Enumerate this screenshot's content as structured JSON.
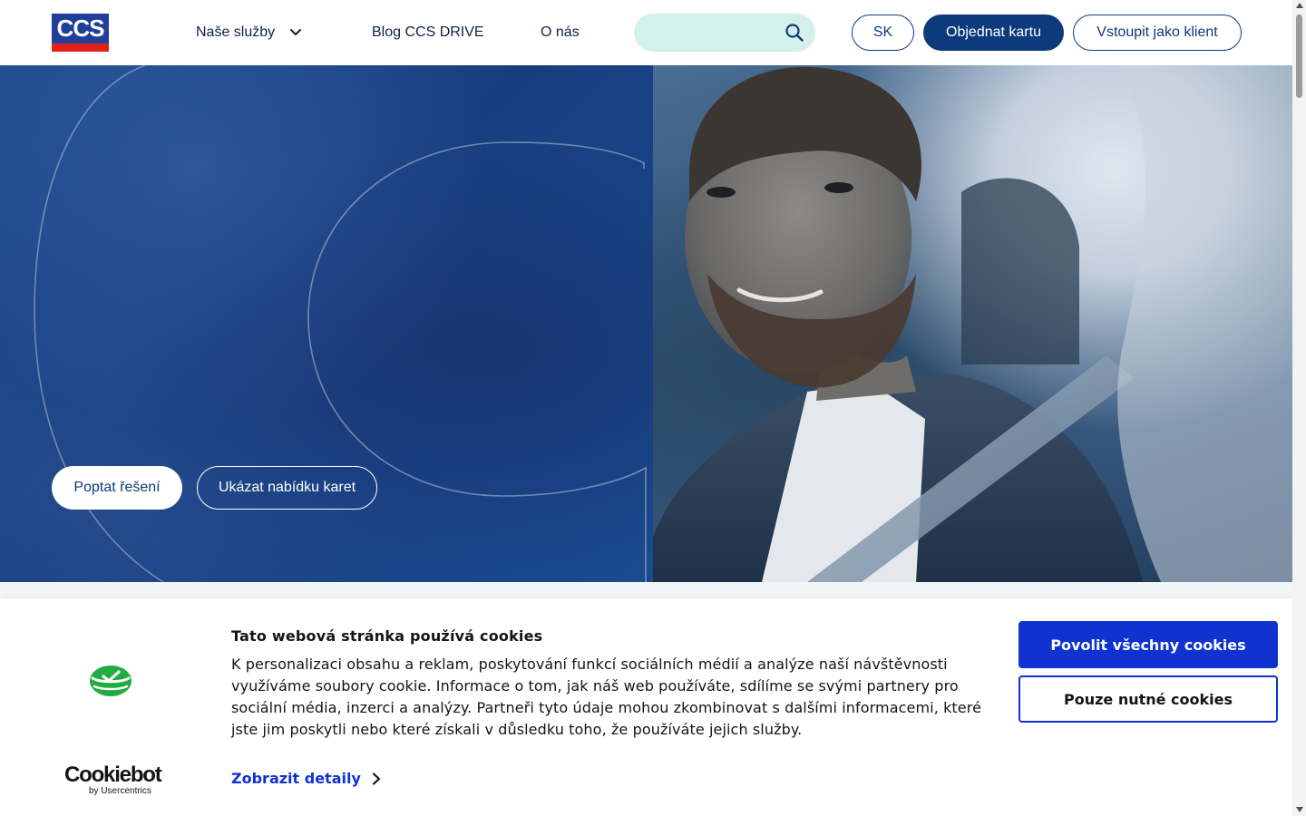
{
  "header": {
    "logo_text": "CCS",
    "nav": {
      "services": "Naše služby",
      "blog": "Blog CCS DRIVE",
      "about": "O nás"
    },
    "search": {
      "placeholder": "",
      "icon": "search-icon"
    },
    "buttons": {
      "language": "SK",
      "order_card": "Objednat kartu",
      "client_login": "Vstoupit jako klient"
    }
  },
  "hero": {
    "primary_button": "Poptat řešení",
    "secondary_button": "Ukázat nabídku karet"
  },
  "cookie_banner": {
    "brand": "Cookiebot",
    "brand_sub": "by Usercentrics",
    "title": "Tato webová stránka používá cookies",
    "text": "K personalizaci obsahu a reklam, poskytování funkcí sociálních médií a analýze naší návštěvnosti využíváme soubory cookie. Informace o tom, jak náš web používáte, sdílíme se svými partnery pro sociální média, inzerci a analýzy. Partneři tyto údaje mohou zkombinovat s dalšími informacemi, které jste jim poskytli nebo které získali v důsledku toho, že používáte jejich služby.",
    "details_link": "Zobrazit detaily",
    "allow_all_button": "Povolit všechny cookies",
    "necessary_only_button": "Pouze nutné cookies"
  },
  "colors": {
    "brand_navy": "#0d3a7a",
    "logo_blue": "#1f3f9a",
    "logo_red": "#e2231a",
    "search_bg": "#d3f1ea",
    "cookie_accent": "#1032cf",
    "cookiebot_green": "#1ead3e"
  }
}
